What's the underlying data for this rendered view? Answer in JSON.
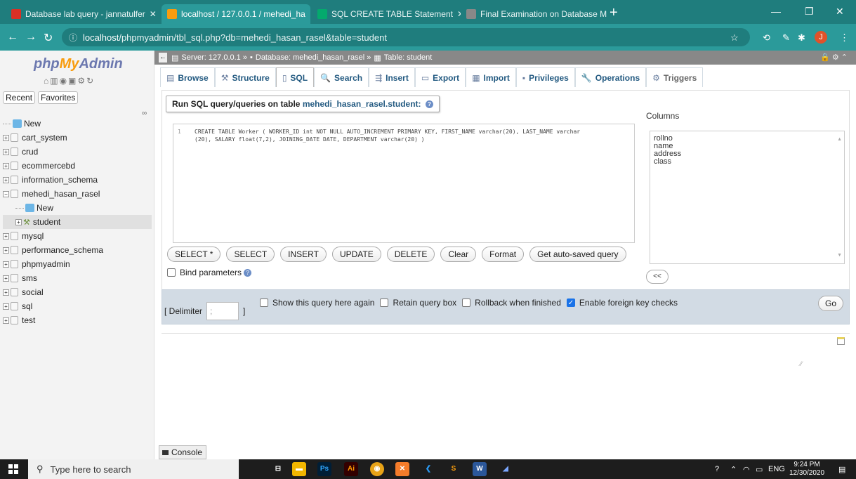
{
  "browser": {
    "tabs": [
      {
        "title": "Database lab query - jannatulfer",
        "favicon": "gmail-icon",
        "color": "#d93025"
      },
      {
        "title": "localhost / 127.0.0.1 / mehedi_ha",
        "favicon": "phpmyadmin-icon",
        "color": "#f89c0e"
      },
      {
        "title": "SQL CREATE TABLE Statement",
        "favicon": "w3schools-icon",
        "color": "#04aa6d"
      },
      {
        "title": "Final Examination on Database M",
        "favicon": "classroom-icon",
        "color": "#666666"
      }
    ],
    "url_host": "localhost",
    "url_path": "/phpmyadmin/tbl_sql.php?db=mehedi_hasan_rasel&table=student",
    "profile_initial": "J"
  },
  "sidebar": {
    "logo_php": "php",
    "logo_my": "My",
    "logo_admin": "Admin",
    "tab_recent": "Recent",
    "tab_favorites": "Favorites",
    "tree": [
      {
        "label": "New",
        "kind": "new"
      },
      {
        "label": "cart_system",
        "kind": "db"
      },
      {
        "label": "crud",
        "kind": "db"
      },
      {
        "label": "ecommercebd",
        "kind": "db"
      },
      {
        "label": "information_schema",
        "kind": "db"
      },
      {
        "label": "mehedi_hasan_rasel",
        "kind": "db-open"
      },
      {
        "label": "New",
        "kind": "sub-new"
      },
      {
        "label": "student",
        "kind": "table"
      },
      {
        "label": "mysql",
        "kind": "db"
      },
      {
        "label": "performance_schema",
        "kind": "db"
      },
      {
        "label": "phpmyadmin",
        "kind": "db"
      },
      {
        "label": "sms",
        "kind": "db"
      },
      {
        "label": "social",
        "kind": "db"
      },
      {
        "label": "sql",
        "kind": "db"
      },
      {
        "label": "test",
        "kind": "db"
      }
    ]
  },
  "breadcrumb": {
    "server": "Server: 127.0.0.1 »",
    "database": "Database: mehedi_hasan_rasel »",
    "table": "Table: student"
  },
  "menu_tabs": [
    {
      "label": "Browse",
      "icon": "▤"
    },
    {
      "label": "Structure",
      "icon": "⚒"
    },
    {
      "label": "SQL",
      "icon": "▯"
    },
    {
      "label": "Search",
      "icon": "🔍"
    },
    {
      "label": "Insert",
      "icon": "⇶"
    },
    {
      "label": "Export",
      "icon": "▭"
    },
    {
      "label": "Import",
      "icon": "▦"
    },
    {
      "label": "Privileges",
      "icon": "▪"
    },
    {
      "label": "Operations",
      "icon": "🔧"
    },
    {
      "label": "Triggers",
      "icon": "⚙"
    }
  ],
  "sql": {
    "legend_prefix": "Run SQL query/queries on table ",
    "legend_table": "mehedi_hasan_rasel.student:",
    "line_number": "1",
    "query": "CREATE TABLE Worker ( WORKER_ID int NOT NULL AUTO_INCREMENT PRIMARY KEY, FIRST_NAME varchar(20), LAST_NAME varchar\n(20), SALARY float(7,2), JOINING_DATE DATE, DEPARTMENT varchar(20) )",
    "columns_label": "Columns",
    "columns": [
      "rollno",
      "name",
      "address",
      "class"
    ],
    "insert_button": "<<",
    "buttons": [
      "SELECT *",
      "SELECT",
      "INSERT",
      "UPDATE",
      "DELETE",
      "Clear",
      "Format",
      "Get auto-saved query"
    ],
    "bind_parameters": "Bind parameters"
  },
  "options": {
    "delimiter_label": "[ Delimiter",
    "delimiter_close": "]",
    "delimiter_value": ";",
    "show_query": "Show this query here again",
    "retain_box": "Retain query box",
    "rollback": "Rollback when finished",
    "foreign_keys": "Enable foreign key checks",
    "go": "Go"
  },
  "console_label": "Console",
  "taskbar": {
    "search_placeholder": "Type here to search",
    "time": "9:24 PM",
    "date": "12/30/2020",
    "lang": "ENG"
  }
}
